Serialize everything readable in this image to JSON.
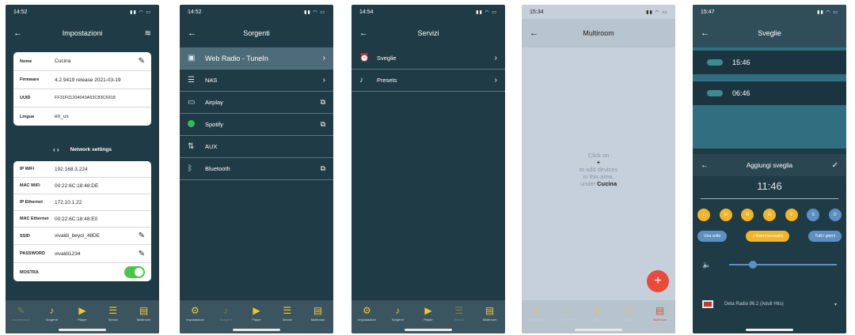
{
  "nav": {
    "impostazioni": "Impostazioni",
    "sorgenti": "Sorgenti",
    "player": "Player",
    "servizi": "Servizi",
    "multiroom": "Multiroom"
  },
  "screen1": {
    "time": "14:52",
    "title": "Impostazioni",
    "device": [
      {
        "key": "Nome",
        "value": "Cucina"
      },
      {
        "key": "Firmware",
        "value": "4.2.9419 release 2021-03-19"
      },
      {
        "key": "UUID",
        "value": "FF31F01204043A53C83C6918"
      },
      {
        "key": "Lingua",
        "value": "en_us"
      }
    ],
    "network_title": "Network settings",
    "network": [
      {
        "key": "IP WiFi",
        "value": "192.168.3.224"
      },
      {
        "key": "MAC WiFi",
        "value": "00:22:6C:18:48:DE"
      },
      {
        "key": "IP Ethernet",
        "value": "172.10.1.22"
      },
      {
        "key": "MAC Ethernet",
        "value": "00:22:6C:18:48:E0"
      },
      {
        "key": "SSID",
        "value": "vivaldi_beyoi_48DE"
      },
      {
        "key": "PASSWORD",
        "value": "vivaldi1234"
      },
      {
        "key": "MOSTRA",
        "value": ""
      }
    ]
  },
  "screen2": {
    "time": "14:52",
    "title": "Sorgenti",
    "items": [
      {
        "label": "Web Radio - TuneIn"
      },
      {
        "label": "NAS"
      },
      {
        "label": "Airplay"
      },
      {
        "label": "Spotify"
      },
      {
        "label": "AUX"
      },
      {
        "label": "Bluetooth"
      }
    ]
  },
  "screen3": {
    "time": "14:54",
    "title": "Servizi",
    "items": [
      {
        "label": "Sveglie"
      },
      {
        "label": "Presets"
      }
    ]
  },
  "screen4": {
    "time": "15:34",
    "title": "Multiroom",
    "msg_l1": "Click on",
    "msg_plus": "+",
    "msg_l2": "to add devices",
    "msg_l3": "in this area,",
    "msg_l4_a": "under",
    "msg_l4_b": "Cucina"
  },
  "screen5": {
    "time": "15:47",
    "title": "Sveglie",
    "alarms": [
      "15:46",
      "06:46"
    ],
    "add_title": "Aggiungi sveglia",
    "new_time": "11:46",
    "days": [
      "L",
      "M",
      "M",
      "G",
      "V",
      "S",
      "D"
    ],
    "chip_once": "Una volta",
    "chip_weekdays": "Giorni lavorativi",
    "chip_all": "Tutti i giorni",
    "source_label": "Deta Radio 96.2 (Adult Hits)"
  }
}
